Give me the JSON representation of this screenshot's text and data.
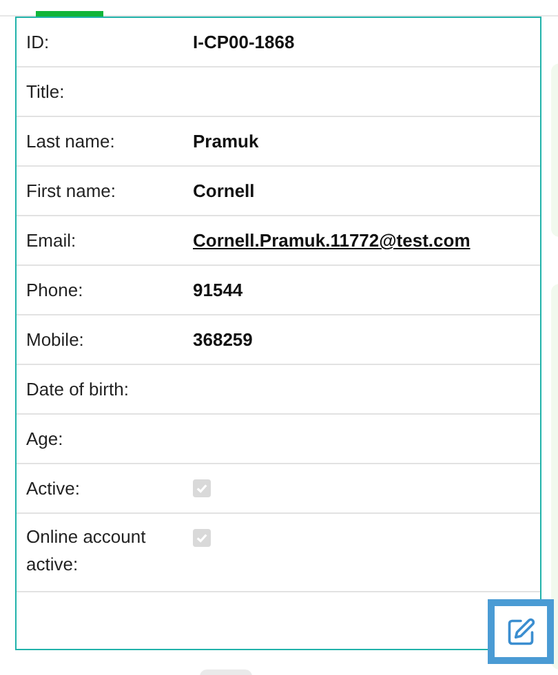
{
  "fields": [
    {
      "kind": "text",
      "label": "ID:",
      "value": "I-CP00-1868"
    },
    {
      "kind": "text",
      "label": "Title:"
    },
    {
      "kind": "text",
      "label": "Last name:",
      "value": "Pramuk"
    },
    {
      "kind": "text",
      "label": "First name:",
      "value": "Cornell"
    },
    {
      "kind": "link",
      "label": "Email:",
      "value": "Cornell.Pramuk.11772@test.com"
    },
    {
      "kind": "text",
      "label": "Phone:",
      "value": "91544"
    },
    {
      "kind": "text",
      "label": "Mobile:",
      "value": "368259"
    },
    {
      "kind": "text",
      "label": "Date of birth:"
    },
    {
      "kind": "text",
      "label": "Age:"
    },
    {
      "kind": "checkbox",
      "label": "Active:",
      "checked": true,
      "disabled": true
    },
    {
      "kind": "checkbox",
      "label": "Online account active:",
      "checked": true,
      "disabled": true
    }
  ],
  "edit_button": {
    "focused": true
  }
}
